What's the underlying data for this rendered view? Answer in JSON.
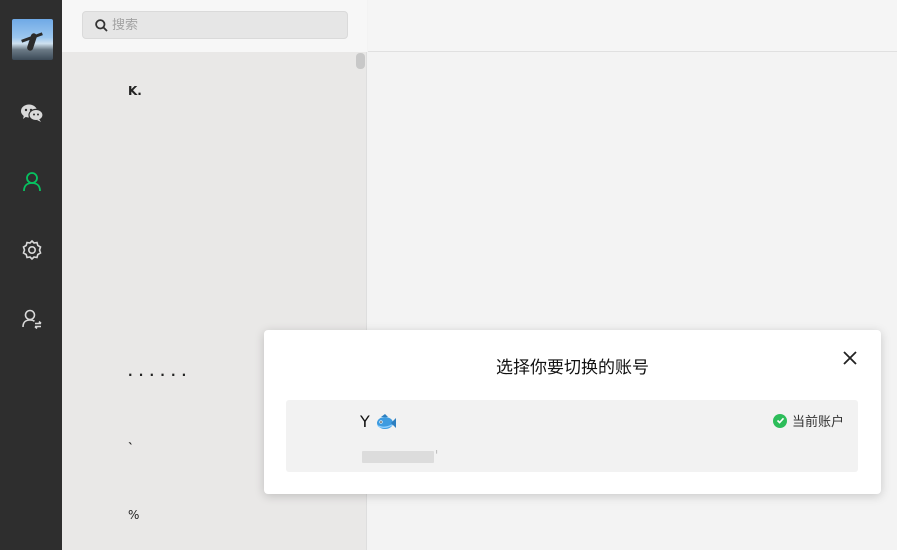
{
  "rail": {
    "items": [
      {
        "icon": "chat-icon",
        "active": false
      },
      {
        "icon": "contacts-icon",
        "active": true
      },
      {
        "icon": "settings-gear-icon",
        "active": false
      },
      {
        "icon": "switch-account-icon",
        "active": false
      }
    ],
    "colors": {
      "background": "#2e2e2e",
      "icon": "#d9d9d9",
      "active": "#07c160"
    }
  },
  "search": {
    "placeholder": "搜索"
  },
  "contacts": [
    {
      "label": "K."
    },
    {
      "label": "· · · · · ·"
    },
    {
      "label": "`"
    },
    {
      "label": "%"
    }
  ],
  "modal": {
    "title": "选择你要切换的账号",
    "account": {
      "name": "Y",
      "avatar_icon": "fish-emoji-icon",
      "status": "当前账户",
      "status_color": "#2dbd5a"
    }
  }
}
